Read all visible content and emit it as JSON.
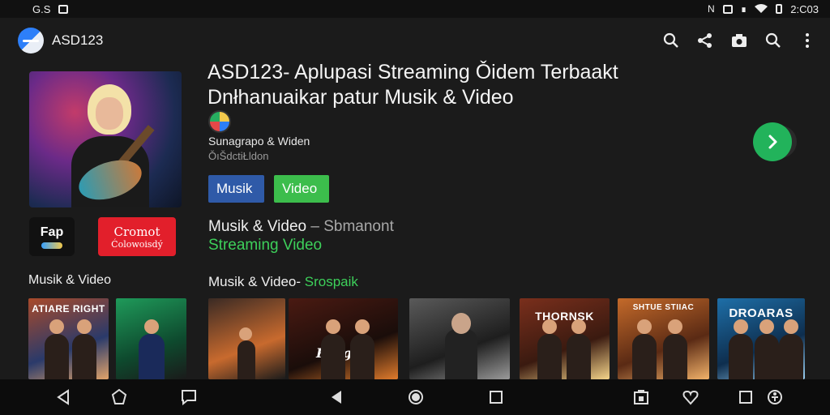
{
  "status_bar": {
    "left_text": "G.S",
    "time": "2:C03",
    "icons": [
      "gallery-icon",
      "nfc-icon",
      "vibrate-icon",
      "bluetooth-icon",
      "wifi-icon",
      "battery-icon"
    ]
  },
  "app_bar": {
    "app_name": "ASD123",
    "actions": [
      "search-icon",
      "share-icon",
      "camera-icon",
      "search-icon",
      "more-vert-icon"
    ]
  },
  "hero": {
    "title": "ASD123- Aplupasi Streaming Ǒidem Terbaakt Dnłhanuaikar patur Musik & Video",
    "channel_name": "Sunagrapo & Widen",
    "channel_sub": "ǑıŠdctiŁldon",
    "chips": [
      "Musik",
      "Video"
    ],
    "subtitle_main": "Musik & Video",
    "subtitle_sep": " – ",
    "subtitle_muted": "Sbmanont",
    "subtitle_green": "Streaming Video",
    "play_icon": "play-arrow-icon",
    "play_color": "#22b35b"
  },
  "left_tiles": {
    "fab_label": "Fap",
    "red_title": "Cromot",
    "red_sub": "Ćolowoisdý"
  },
  "left_section_title": "Musik & Video",
  "row": {
    "title_main": "Musik & Video- ",
    "title_green": "Srospaik",
    "thumbnails": [
      {
        "caption": "",
        "palette": [
          "#3a2a24",
          "#c86a2e",
          "#1b1b1b"
        ]
      },
      {
        "caption": "Rotgab",
        "palette": [
          "#4a1a12",
          "#1a0d0a",
          "#e07b2c"
        ]
      },
      {
        "caption": "",
        "palette": [
          "#5a5a5a",
          "#1e1e1e",
          "#9a9a9a"
        ]
      },
      {
        "caption": "THORNSK",
        "palette": [
          "#7a2f1c",
          "#3a1a10",
          "#f4d48a"
        ]
      },
      {
        "caption": "SHTUE STIIAC",
        "palette": [
          "#c46a2a",
          "#5a2a14",
          "#f2b26a"
        ]
      },
      {
        "caption": "DROARAS",
        "palette": [
          "#1e6fa8",
          "#0e2e4e",
          "#9ad0f2"
        ]
      }
    ]
  },
  "left_row": {
    "thumbnails": [
      {
        "caption": "ATIARE RIGHT",
        "palette": [
          "#a94a2a",
          "#2a3a6a",
          "#e0a36a"
        ]
      },
      {
        "caption": "",
        "palette": [
          "#1f9a5a",
          "#0e4a2e",
          "#1a1a1a"
        ]
      }
    ]
  },
  "nav_bar": {
    "buttons": [
      "back-icon",
      "home-icon",
      "chat-icon",
      "back-filled-icon",
      "home-filled-icon",
      "recents-icon",
      "screenshot-icon",
      "heart-icon",
      "square-icon",
      "accessibility-icon"
    ]
  }
}
